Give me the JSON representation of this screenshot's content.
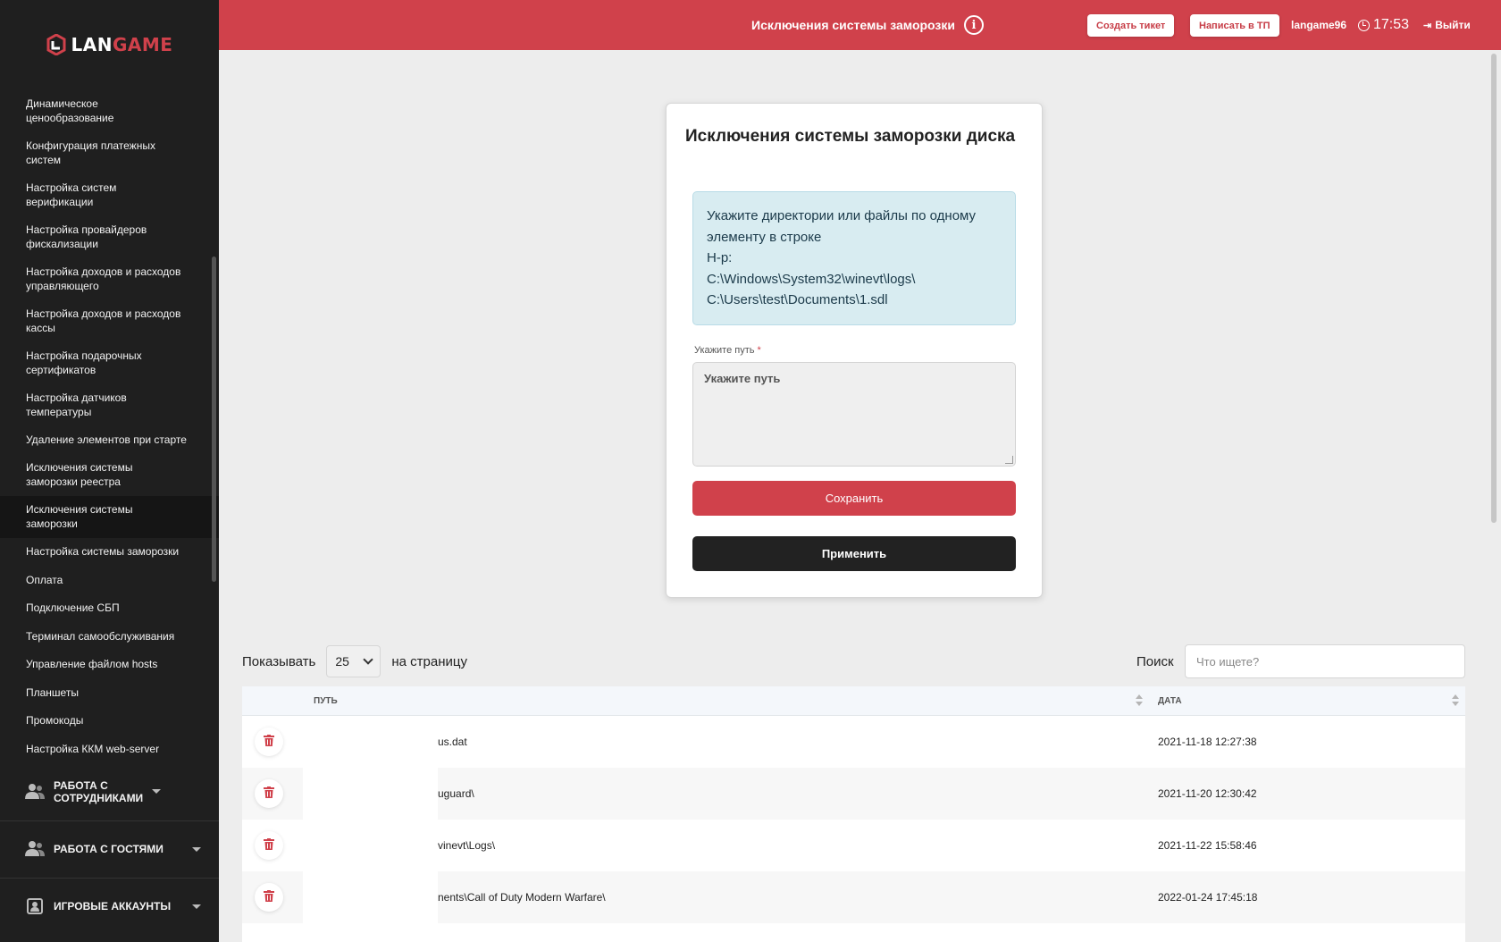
{
  "brand": {
    "lan": "LAN",
    "game": "GAME"
  },
  "sidebar": {
    "items": [
      {
        "label": "Динамическое ценообразование",
        "lines": 2
      },
      {
        "label": "Конфигурация платежных систем",
        "lines": 2
      },
      {
        "label": "Настройка систем верификации",
        "lines": 2
      },
      {
        "label": "Настройка провайдеров фискализации",
        "lines": 2
      },
      {
        "label": "Настройка доходов и расходов управляющего",
        "lines": 2
      },
      {
        "label": "Настройка доходов и расходов кассы",
        "lines": 2
      },
      {
        "label": "Настройка подарочных сертификатов",
        "lines": 2
      },
      {
        "label": "Настройка датчиков температуры",
        "lines": 2
      },
      {
        "label": "Удаление элементов при старте",
        "lines": 1
      },
      {
        "label": "Исключения системы заморозки реестра",
        "lines": 2
      },
      {
        "label": "Исключения системы заморозки",
        "lines": 2,
        "active": true
      },
      {
        "label": "Настройка системы заморозки",
        "lines": 1
      },
      {
        "label": "Оплата",
        "lines": 1
      },
      {
        "label": "Подключение СБП",
        "lines": 1
      },
      {
        "label": "Терминал самообслуживания",
        "lines": 1
      },
      {
        "label": "Управление файлом hosts",
        "lines": 1
      },
      {
        "label": "Планшеты",
        "lines": 1
      },
      {
        "label": "Промокоды",
        "lines": 1
      },
      {
        "label": "Настройка ККМ web-server",
        "lines": 1
      }
    ],
    "sections": [
      {
        "label": "Работа с сотрудниками",
        "icon": "users-icon"
      },
      {
        "label": "Работа с гостями",
        "icon": "users-icon"
      },
      {
        "label": "Игровые аккаунты",
        "icon": "account-icon"
      }
    ]
  },
  "header": {
    "title": "Исключения системы заморозки",
    "create_ticket": "Создать тикет",
    "write_support": "Написать в ТП",
    "username": "langame96",
    "time": "17:53",
    "logout": "Выйти"
  },
  "card": {
    "title": "Исключения системы заморозки диска",
    "info_lines": [
      "Укажите директории или файлы по одному",
      "элементу в строке",
      "Н-р:",
      "C:\\Windows\\System32\\winevt\\logs\\",
      "C:\\Users\\test\\Documents\\1.sdl"
    ],
    "field_label": "Укажите путь",
    "field_placeholder": "Укажите путь",
    "save_label": "Сохранить",
    "apply_label": "Применить"
  },
  "table_controls": {
    "show_label": "Показывать",
    "page_size": "25",
    "per_page_label": "на страницу",
    "search_label": "Поиск",
    "search_placeholder": "Что ищете?"
  },
  "table": {
    "columns": [
      "Путь",
      "Дата"
    ],
    "rows": [
      {
        "path": "us.dat",
        "date": "2021-11-18 12:27:38"
      },
      {
        "path": "uguard\\",
        "date": "2021-11-20 12:30:42"
      },
      {
        "path": "vinevt\\Logs\\",
        "date": "2021-11-22 15:58:46"
      },
      {
        "path": "nents\\Call of Duty Modern Warfare\\",
        "date": "2022-01-24 17:45:18"
      }
    ]
  },
  "colors": {
    "accent": "#d0414b",
    "sidebar_bg": "#1f1f1f",
    "info_bg": "#d8ecf1",
    "apply_bg": "#222222"
  }
}
